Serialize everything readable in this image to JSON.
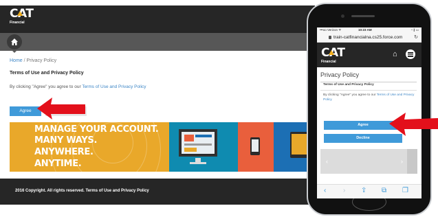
{
  "desktop": {
    "logo": {
      "text": "CAT",
      "sub": "Financial"
    },
    "breadcrumb": {
      "home": "Home",
      "sep": " / ",
      "current": "Privacy Policy"
    },
    "page_title": "Terms of Use and Privacy Policy",
    "body": {
      "prefix": "By clicking \"Agree\" you agree to our ",
      "link": "Terms of Use and Privacy Policy"
    },
    "agree_label": "Agree",
    "banner": {
      "lines": [
        "MANAGE YOUR ACCOUNT.",
        "MANY WAYS.",
        "ANYWHERE.",
        "ANYTIME."
      ],
      "colors": {
        "yellow": "#e9a82a",
        "teal": "#0f8bb0",
        "orange": "#e95f3c",
        "blue": "#1c6fb4"
      }
    },
    "footer": "2016 Copyright. All rights reserved.    Terms of Use and Privacy Policy"
  },
  "mobile": {
    "status": {
      "carrier": "•••oo Verizon ᯤ",
      "time": "10:23 AM",
      "battery": "◔ ∦ ▭"
    },
    "url": "train-catfinancialna.cs25.force.com",
    "logo": {
      "text": "CAT",
      "sub": "Financial"
    },
    "title": "Privacy Policy",
    "subtitle": "Terms of Use and Privacy Policy",
    "body": {
      "prefix": "By clicking \"Agree\" you agree to our ",
      "link": "Terms of Use and Privacy Policy"
    },
    "agree_label": "Agree",
    "decline_label": "Decline",
    "toolbar": {
      "back": "‹",
      "forward": "›",
      "share": "⇪",
      "bookmarks": "⧉",
      "tabs": "❐"
    },
    "prev": "‹",
    "next": "›"
  },
  "colors": {
    "accent": "#3f9ad9",
    "header": "#262626",
    "arrow": "#e3101b"
  }
}
